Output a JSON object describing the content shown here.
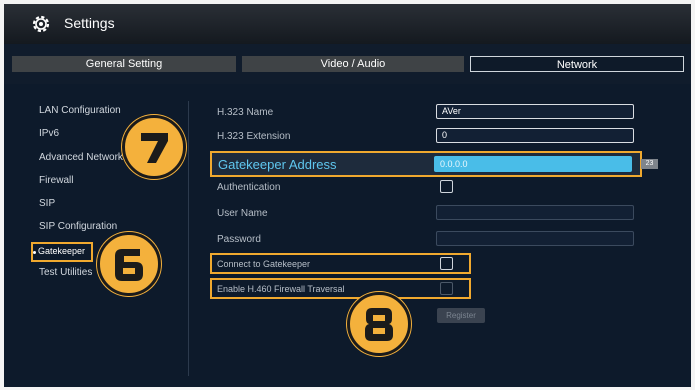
{
  "window": {
    "title": "Settings",
    "icon": "gear-icon"
  },
  "tabs": [
    {
      "label": "General Setting",
      "active": false
    },
    {
      "label": "Video / Audio",
      "active": false
    },
    {
      "label": "Network",
      "active": true
    }
  ],
  "sidebar": {
    "items": [
      {
        "label": "LAN Configuration"
      },
      {
        "label": "IPv6"
      },
      {
        "label": "Advanced Network"
      },
      {
        "label": "Firewall"
      },
      {
        "label": "SIP"
      },
      {
        "label": "SIP Configuration"
      },
      {
        "label": "Gatekeeper",
        "selected": true
      },
      {
        "label": "Test Utilities"
      }
    ]
  },
  "form": {
    "h323_name": {
      "label": "H.323 Name",
      "value": "AVer"
    },
    "h323_extension": {
      "label": "H.323 Extension",
      "value": "0"
    },
    "gatekeeper_address": {
      "label": "Gatekeeper Address",
      "value": "0.0.0.0",
      "char_count": "23"
    },
    "authentication": {
      "label": "Authentication",
      "checked": false
    },
    "user_name": {
      "label": "User Name",
      "value": ""
    },
    "password": {
      "label": "Password",
      "value": ""
    },
    "connect_to_gatekeeper": {
      "label": "Connect to Gatekeeper",
      "checked": false
    },
    "h460_firewall": {
      "label": "Enable H.460 Firewall Traversal",
      "checked": false
    },
    "register_label": "Register"
  },
  "callouts": [
    "7",
    "6",
    "8"
  ],
  "colors": {
    "accent": "#f0a92f",
    "highlight_blue": "#49bde8",
    "background": "#0d1a2b"
  }
}
